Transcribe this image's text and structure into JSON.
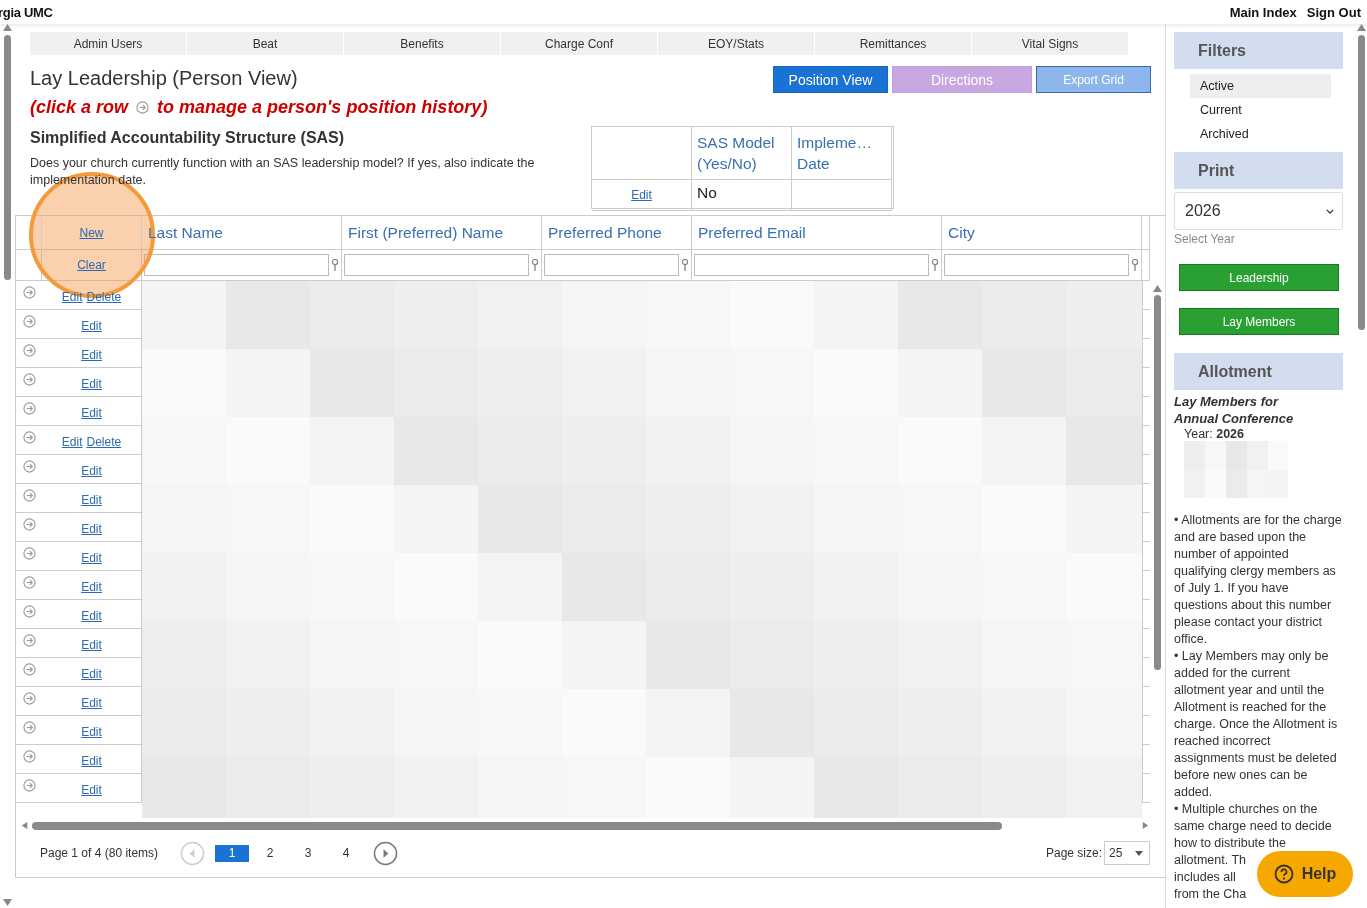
{
  "header": {
    "brand": "rgia UMC",
    "links": [
      "Main Index",
      "Sign Out"
    ]
  },
  "tabs": [
    "Admin Users",
    "Beat",
    "Benefits",
    "Charge Conf",
    "EOY/Stats",
    "Remittances",
    "Vital Signs"
  ],
  "page_title": "Lay Leadership (Person View)",
  "buttons": [
    {
      "label": "Position View",
      "kind": "primary"
    },
    {
      "label": "Directions",
      "kind": "purple"
    },
    {
      "label": "Export Grid",
      "kind": "light"
    }
  ],
  "hint": {
    "before": "(click a row",
    "after": "to manage a person's position history)"
  },
  "sas": {
    "title": "Simplified Accountability Structure (SAS)",
    "description": "Does your church currently function with an SAS leadership model? If yes, also indicate the implementation date.",
    "columns": [
      "SAS Model (Yes/No)",
      "Impleme… Date"
    ],
    "row": {
      "action": "Edit",
      "sas_model": "No"
    }
  },
  "grid": {
    "new_label": "New",
    "clear_label": "Clear",
    "columns": [
      "Last Name",
      "First (Preferred) Name",
      "Preferred Phone",
      "Preferred Email",
      "City"
    ],
    "rows": [
      {
        "actions": [
          "Edit",
          "Delete"
        ]
      },
      {
        "actions": [
          "Edit"
        ]
      },
      {
        "actions": [
          "Edit"
        ]
      },
      {
        "actions": [
          "Edit"
        ]
      },
      {
        "actions": [
          "Edit"
        ]
      },
      {
        "actions": [
          "Edit",
          "Delete"
        ]
      },
      {
        "actions": [
          "Edit"
        ]
      },
      {
        "actions": [
          "Edit"
        ]
      },
      {
        "actions": [
          "Edit"
        ]
      },
      {
        "actions": [
          "Edit"
        ]
      },
      {
        "actions": [
          "Edit"
        ]
      },
      {
        "actions": [
          "Edit"
        ]
      },
      {
        "actions": [
          "Edit"
        ]
      },
      {
        "actions": [
          "Edit"
        ]
      },
      {
        "actions": [
          "Edit"
        ]
      },
      {
        "actions": [
          "Edit"
        ]
      },
      {
        "actions": [
          "Edit"
        ]
      },
      {
        "actions": [
          "Edit"
        ]
      }
    ],
    "pager": {
      "summary": "Page 1 of 4 (80 items)",
      "pages": [
        {
          "label": "1",
          "selected": true
        },
        {
          "label": "2",
          "selected": false
        },
        {
          "label": "3",
          "selected": false
        },
        {
          "label": "4",
          "selected": false
        }
      ],
      "page_size_label": "Page size:",
      "page_size": "25"
    }
  },
  "sidebar": {
    "filters": {
      "title": "Filters",
      "items": [
        {
          "label": "Active",
          "selected": true
        },
        {
          "label": "Current",
          "selected": false
        },
        {
          "label": "Archived",
          "selected": false
        }
      ]
    },
    "print": {
      "title": "Print",
      "year": "2026",
      "year_label": "Select Year",
      "buttons": [
        "Leadership",
        "Lay Members"
      ]
    },
    "allotment": {
      "title": "Allotment",
      "subtitle": "Lay Members for Annual Conference",
      "year_label": "Year:",
      "year": "2026",
      "notes": [
        "• Allotments are for the charge and are based upon the number of appointed qualifying clergy members as of July 1. If you have questions about this number please contact your district office.",
        "• Lay Members may only be added for the current allotment year and until the Allotment is reached for the charge. Once the Allotment is reached incorrect assignments must be deleted before new ones can be added."
      ],
      "cut_note_lines": [
        "• Multiple churches on the",
        "same charge need to decide",
        "how to distribute the",
        "allotment. Th",
        "includes all",
        "from the Cha"
      ]
    }
  },
  "help": {
    "label": "Help"
  }
}
